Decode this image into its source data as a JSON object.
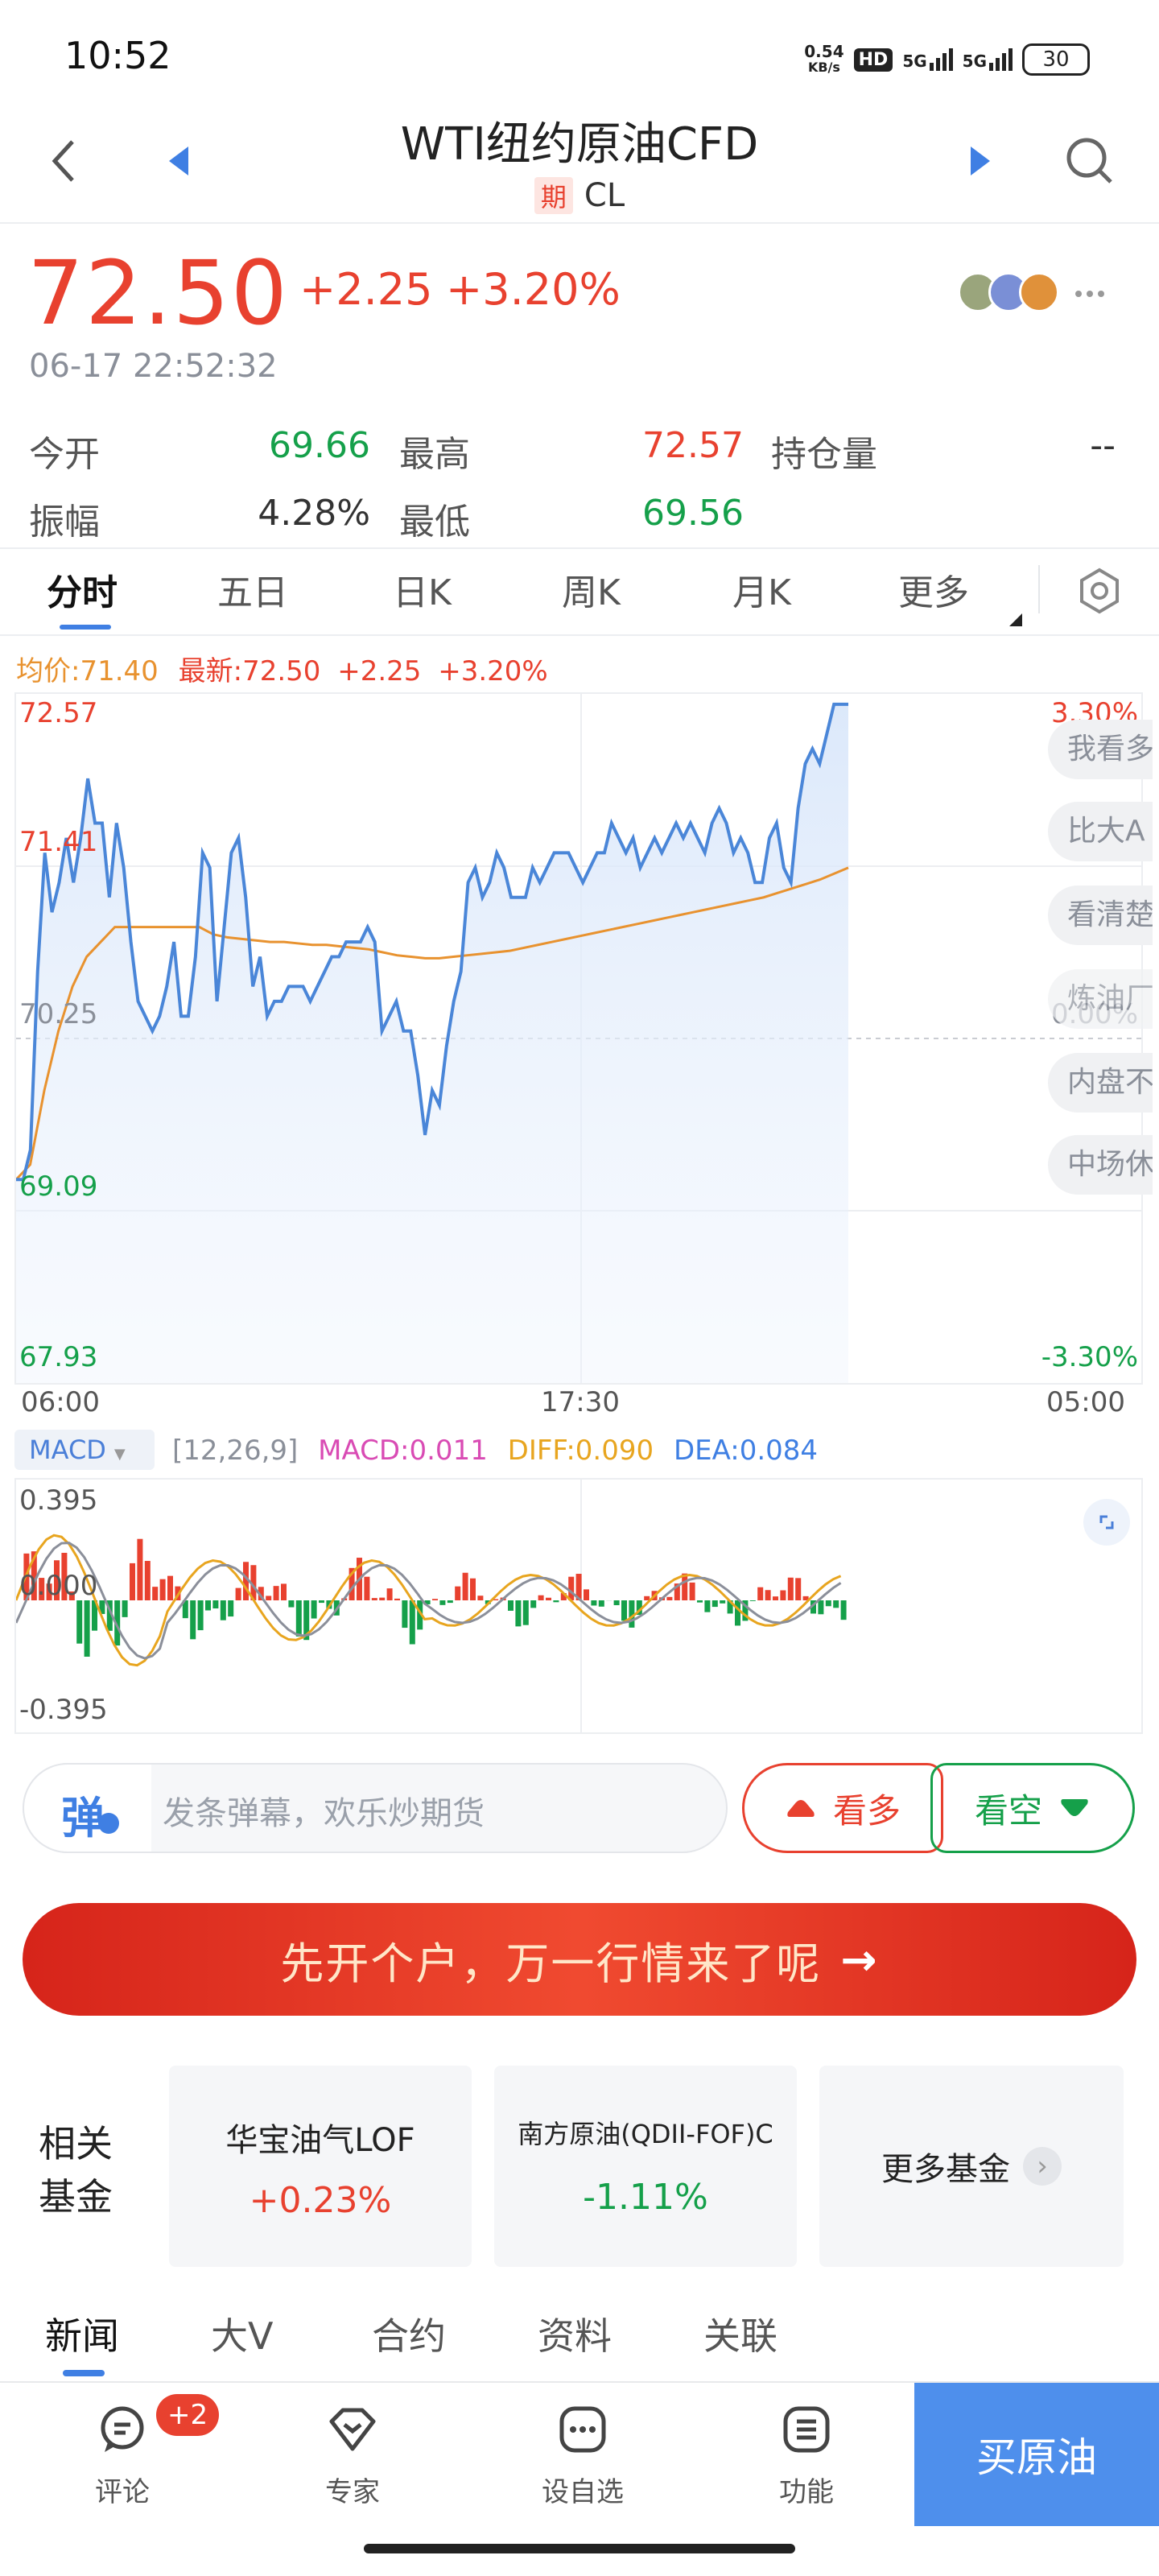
{
  "status_bar": {
    "time": "10:52",
    "speed_top": "0.54",
    "speed_bottom": "KB/s",
    "hd": "HD",
    "net1": "5G",
    "net2": "5G",
    "battery": "30"
  },
  "header": {
    "title": "WTI纽约原油CFD",
    "badge": "期",
    "code": "CL"
  },
  "quote": {
    "price": "72.50",
    "change": "+2.25",
    "change_pct": "+3.20%",
    "time": "06-17 22:52:32",
    "stats": {
      "open_label": "今开",
      "open": "69.66",
      "high_label": "最高",
      "high": "72.57",
      "oi_label": "持仓量",
      "oi": "--",
      "amp_label": "振幅",
      "amp": "4.28%",
      "low_label": "最低",
      "low": "69.56"
    }
  },
  "chart_tabs": [
    "分时",
    "五日",
    "日K",
    "周K",
    "月K",
    "更多"
  ],
  "legend": {
    "avg": "均价:71.40",
    "last": "最新:72.50",
    "chg": "+2.25",
    "pct": "+3.20%"
  },
  "main_chart": {
    "y_left": [
      "72.57",
      "71.41",
      "70.25",
      "69.09",
      "67.93"
    ],
    "y_right_top": "3.30%",
    "y_right_mid": "0.00%",
    "y_right_bottom": "-3.30%",
    "x_labels": [
      "06:00",
      "17:30",
      "05:00"
    ],
    "side_pills": [
      "我看多",
      "比大A",
      "看清楚",
      "炼油厂",
      "内盘不",
      "中场休"
    ]
  },
  "chart_data": {
    "type": "line",
    "title": "",
    "x_labels": [
      "06:00",
      "17:30",
      "05:00"
    ],
    "ylim": [
      67.93,
      72.57
    ],
    "series": [
      {
        "name": "最新",
        "color": "#4a86d8",
        "values": [
          69.3,
          69.3,
          69.5,
          70.7,
          71.5,
          71.1,
          71.3,
          71.6,
          71.3,
          71.6,
          72.0,
          71.7,
          71.7,
          71.2,
          71.7,
          71.4,
          70.9,
          70.5,
          70.4,
          70.3,
          70.4,
          70.6,
          70.9,
          70.4,
          70.4,
          70.8,
          71.5,
          71.4,
          70.5,
          71.0,
          71.5,
          71.6,
          71.2,
          70.6,
          70.8,
          70.4,
          70.5,
          70.5,
          70.6,
          70.6,
          70.6,
          70.5,
          70.6,
          70.7,
          70.8,
          70.8,
          70.9,
          70.9,
          70.9,
          71.0,
          70.9,
          70.3,
          70.4,
          70.5,
          70.3,
          70.3,
          70.0,
          69.6,
          69.9,
          69.8,
          70.2,
          70.5,
          70.7,
          71.3,
          71.4,
          71.2,
          71.3,
          71.5,
          71.4,
          71.2,
          71.2,
          71.2,
          71.4,
          71.3,
          71.4,
          71.5,
          71.5,
          71.5,
          71.4,
          71.3,
          71.4,
          71.5,
          71.5,
          71.7,
          71.6,
          71.5,
          71.6,
          71.4,
          71.5,
          71.6,
          71.5,
          71.6,
          71.7,
          71.6,
          71.7,
          71.6,
          71.5,
          71.7,
          71.8,
          71.7,
          71.5,
          71.6,
          71.5,
          71.3,
          71.3,
          71.6,
          71.7,
          71.4,
          71.3,
          71.8,
          72.1,
          72.2,
          72.1,
          72.3,
          72.5,
          72.5,
          72.5
        ]
      },
      {
        "name": "均价",
        "color": "#e8922f",
        "values": [
          69.3,
          69.4,
          69.9,
          70.3,
          70.6,
          70.8,
          70.9,
          71.0,
          71.0,
          71.0,
          71.0,
          71.0,
          71.0,
          71.0,
          70.95,
          70.93,
          70.92,
          70.91,
          70.9,
          70.9,
          70.89,
          70.88,
          70.88,
          70.87,
          70.86,
          70.85,
          70.83,
          70.81,
          70.8,
          70.79,
          70.79,
          70.8,
          70.81,
          70.82,
          70.83,
          70.84,
          70.86,
          70.88,
          70.9,
          70.92,
          70.94,
          70.96,
          70.98,
          71.0,
          71.02,
          71.04,
          71.06,
          71.08,
          71.1,
          71.12,
          71.14,
          71.16,
          71.18,
          71.2,
          71.23,
          71.26,
          71.29,
          71.32,
          71.36,
          71.4
        ]
      }
    ]
  },
  "macd": {
    "label": "MACD",
    "params": "[12,26,9]",
    "macd_val": "MACD:0.011",
    "diff_val": "DIFF:0.090",
    "dea_val": "DEA:0.084",
    "y_top": "0.395",
    "y_mid": "0.000",
    "y_bottom": "-0.395"
  },
  "danmu": {
    "icon": "弹",
    "placeholder": "发条弹幕，欢乐炒期货",
    "bull": "看多",
    "bear": "看空"
  },
  "promo": {
    "text": "先开个户，万一行情来了呢",
    "arrow": "→"
  },
  "funds": {
    "section_label_1": "相关",
    "section_label_2": "基金",
    "items": [
      {
        "name": "华宝油气LOF",
        "change": "+0.23%"
      },
      {
        "name": "南方原油(QDII-FOF)C",
        "change": "-1.11%"
      }
    ],
    "more": "更多基金"
  },
  "news_tabs": [
    "新闻",
    "大V",
    "合约",
    "资料",
    "关联"
  ],
  "bottom_bar": {
    "items": [
      {
        "label": "评论",
        "badge": "+2"
      },
      {
        "label": "专家"
      },
      {
        "label": "设自选"
      },
      {
        "label": "功能"
      }
    ],
    "buy": "买原油"
  },
  "colors": {
    "up": "#e8412f",
    "down": "#15a04a",
    "line": "#4a86d8",
    "avg": "#e8922f",
    "accent": "#4e8fec"
  }
}
